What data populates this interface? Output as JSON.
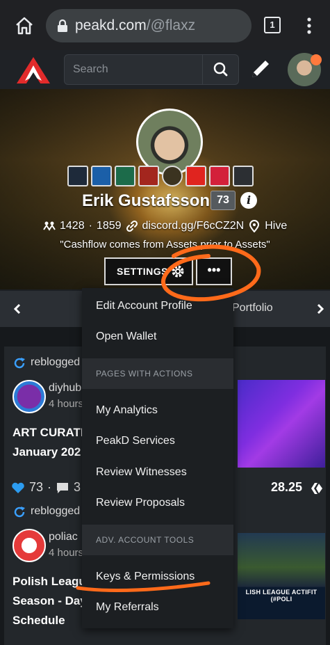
{
  "browser": {
    "url_domain": "peakd.com",
    "url_path": "/@flaxz",
    "tab_count": "1"
  },
  "header": {
    "search_placeholder": "Search"
  },
  "profile": {
    "name": "Erik Gustafsson",
    "reputation": "73",
    "followers": "1428",
    "following": "1859",
    "separator": "·",
    "link": "discord.gg/F6cCZ2N",
    "location": "Hive",
    "tagline": "\"Cashflow comes from Assets prior to Assets\"",
    "settings_label": "SETTINGS",
    "more_label": "•••",
    "badges": [
      "dtube original creator",
      "Referral",
      "mandala",
      "heart-fire",
      "marcoin",
      "thumbs-up",
      "heart",
      "bees"
    ]
  },
  "tabs": {
    "visible_tab": "Portfolio"
  },
  "feed": {
    "posts": [
      {
        "reblog_label": "reblogged",
        "author": "diyhub",
        "time": "4 hours",
        "title_line1": "ART CURATI",
        "title_line2": "January 202",
        "votes": "73",
        "comments_partial": "3",
        "payout": "28.25"
      },
      {
        "reblog_label": "reblogged",
        "author": "poliac",
        "time": "4 hours",
        "title_line1": "Polish Leagu",
        "title_line2": "Season - Day",
        "title_line3": "Schedule",
        "thumb_text": "LISH LEAGUE ACTIFIT (#POLI"
      }
    ]
  },
  "dropdown": {
    "edit_profile": "Edit Account Profile",
    "open_wallet": "Open Wallet",
    "section_pages": "PAGES WITH ACTIONS",
    "my_analytics": "My Analytics",
    "peakd_services": "PeakD Services",
    "review_witnesses": "Review Witnesses",
    "review_proposals": "Review Proposals",
    "section_adv": "ADV. ACCOUNT TOOLS",
    "keys_permissions": "Keys & Permissions",
    "my_referrals": "My Referrals"
  },
  "colors": {
    "annotation": "#ff6a1a",
    "reblog_blue": "#3aa0ff",
    "heart_blue": "#2c9cf0",
    "notification": "#ff7a3d"
  }
}
